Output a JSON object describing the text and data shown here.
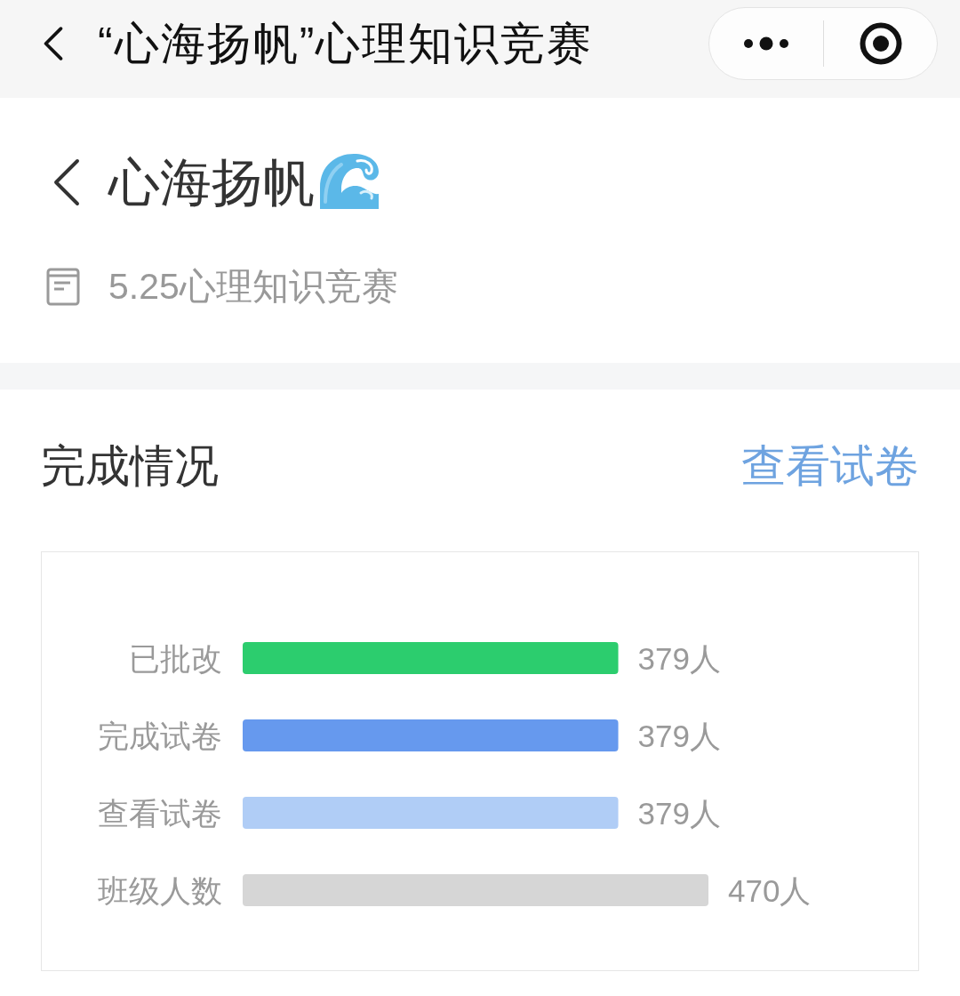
{
  "nav_bar": {
    "title": "“心海扬帆”心理知识竞赛"
  },
  "header": {
    "title": "心海扬帆",
    "subtitle": "5.25心理知识竞赛"
  },
  "completion": {
    "title": "完成情况",
    "link": "查看试卷",
    "chart_data": {
      "type": "bar",
      "orientation": "horizontal",
      "categories": [
        "已批改",
        "完成试卷",
        "查看试卷",
        "班级人数"
      ],
      "values": [
        379,
        379,
        379,
        470
      ],
      "value_labels": [
        "379人",
        "379人",
        "379人",
        "470人"
      ],
      "colors": [
        "#2ccd6e",
        "#6699ee",
        "#b0cdf6",
        "#d6d6d6"
      ]
    }
  }
}
